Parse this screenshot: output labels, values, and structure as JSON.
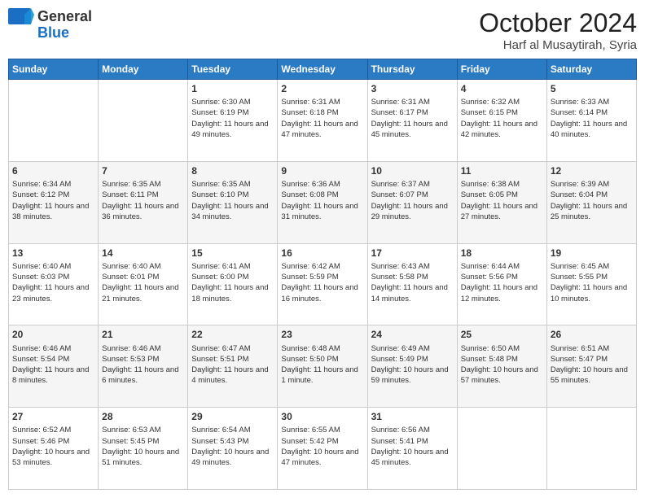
{
  "logo": {
    "general": "General",
    "blue": "Blue"
  },
  "header": {
    "month": "October 2024",
    "location": "Harf al Musaytirah, Syria"
  },
  "weekdays": [
    "Sunday",
    "Monday",
    "Tuesday",
    "Wednesday",
    "Thursday",
    "Friday",
    "Saturday"
  ],
  "weeks": [
    [
      {
        "day": null,
        "info": ""
      },
      {
        "day": null,
        "info": ""
      },
      {
        "day": 1,
        "info": "Sunrise: 6:30 AM\nSunset: 6:19 PM\nDaylight: 11 hours and 49 minutes."
      },
      {
        "day": 2,
        "info": "Sunrise: 6:31 AM\nSunset: 6:18 PM\nDaylight: 11 hours and 47 minutes."
      },
      {
        "day": 3,
        "info": "Sunrise: 6:31 AM\nSunset: 6:17 PM\nDaylight: 11 hours and 45 minutes."
      },
      {
        "day": 4,
        "info": "Sunrise: 6:32 AM\nSunset: 6:15 PM\nDaylight: 11 hours and 42 minutes."
      },
      {
        "day": 5,
        "info": "Sunrise: 6:33 AM\nSunset: 6:14 PM\nDaylight: 11 hours and 40 minutes."
      }
    ],
    [
      {
        "day": 6,
        "info": "Sunrise: 6:34 AM\nSunset: 6:12 PM\nDaylight: 11 hours and 38 minutes."
      },
      {
        "day": 7,
        "info": "Sunrise: 6:35 AM\nSunset: 6:11 PM\nDaylight: 11 hours and 36 minutes."
      },
      {
        "day": 8,
        "info": "Sunrise: 6:35 AM\nSunset: 6:10 PM\nDaylight: 11 hours and 34 minutes."
      },
      {
        "day": 9,
        "info": "Sunrise: 6:36 AM\nSunset: 6:08 PM\nDaylight: 11 hours and 31 minutes."
      },
      {
        "day": 10,
        "info": "Sunrise: 6:37 AM\nSunset: 6:07 PM\nDaylight: 11 hours and 29 minutes."
      },
      {
        "day": 11,
        "info": "Sunrise: 6:38 AM\nSunset: 6:05 PM\nDaylight: 11 hours and 27 minutes."
      },
      {
        "day": 12,
        "info": "Sunrise: 6:39 AM\nSunset: 6:04 PM\nDaylight: 11 hours and 25 minutes."
      }
    ],
    [
      {
        "day": 13,
        "info": "Sunrise: 6:40 AM\nSunset: 6:03 PM\nDaylight: 11 hours and 23 minutes."
      },
      {
        "day": 14,
        "info": "Sunrise: 6:40 AM\nSunset: 6:01 PM\nDaylight: 11 hours and 21 minutes."
      },
      {
        "day": 15,
        "info": "Sunrise: 6:41 AM\nSunset: 6:00 PM\nDaylight: 11 hours and 18 minutes."
      },
      {
        "day": 16,
        "info": "Sunrise: 6:42 AM\nSunset: 5:59 PM\nDaylight: 11 hours and 16 minutes."
      },
      {
        "day": 17,
        "info": "Sunrise: 6:43 AM\nSunset: 5:58 PM\nDaylight: 11 hours and 14 minutes."
      },
      {
        "day": 18,
        "info": "Sunrise: 6:44 AM\nSunset: 5:56 PM\nDaylight: 11 hours and 12 minutes."
      },
      {
        "day": 19,
        "info": "Sunrise: 6:45 AM\nSunset: 5:55 PM\nDaylight: 11 hours and 10 minutes."
      }
    ],
    [
      {
        "day": 20,
        "info": "Sunrise: 6:46 AM\nSunset: 5:54 PM\nDaylight: 11 hours and 8 minutes."
      },
      {
        "day": 21,
        "info": "Sunrise: 6:46 AM\nSunset: 5:53 PM\nDaylight: 11 hours and 6 minutes."
      },
      {
        "day": 22,
        "info": "Sunrise: 6:47 AM\nSunset: 5:51 PM\nDaylight: 11 hours and 4 minutes."
      },
      {
        "day": 23,
        "info": "Sunrise: 6:48 AM\nSunset: 5:50 PM\nDaylight: 11 hours and 1 minute."
      },
      {
        "day": 24,
        "info": "Sunrise: 6:49 AM\nSunset: 5:49 PM\nDaylight: 10 hours and 59 minutes."
      },
      {
        "day": 25,
        "info": "Sunrise: 6:50 AM\nSunset: 5:48 PM\nDaylight: 10 hours and 57 minutes."
      },
      {
        "day": 26,
        "info": "Sunrise: 6:51 AM\nSunset: 5:47 PM\nDaylight: 10 hours and 55 minutes."
      }
    ],
    [
      {
        "day": 27,
        "info": "Sunrise: 6:52 AM\nSunset: 5:46 PM\nDaylight: 10 hours and 53 minutes."
      },
      {
        "day": 28,
        "info": "Sunrise: 6:53 AM\nSunset: 5:45 PM\nDaylight: 10 hours and 51 minutes."
      },
      {
        "day": 29,
        "info": "Sunrise: 6:54 AM\nSunset: 5:43 PM\nDaylight: 10 hours and 49 minutes."
      },
      {
        "day": 30,
        "info": "Sunrise: 6:55 AM\nSunset: 5:42 PM\nDaylight: 10 hours and 47 minutes."
      },
      {
        "day": 31,
        "info": "Sunrise: 6:56 AM\nSunset: 5:41 PM\nDaylight: 10 hours and 45 minutes."
      },
      {
        "day": null,
        "info": ""
      },
      {
        "day": null,
        "info": ""
      }
    ]
  ]
}
